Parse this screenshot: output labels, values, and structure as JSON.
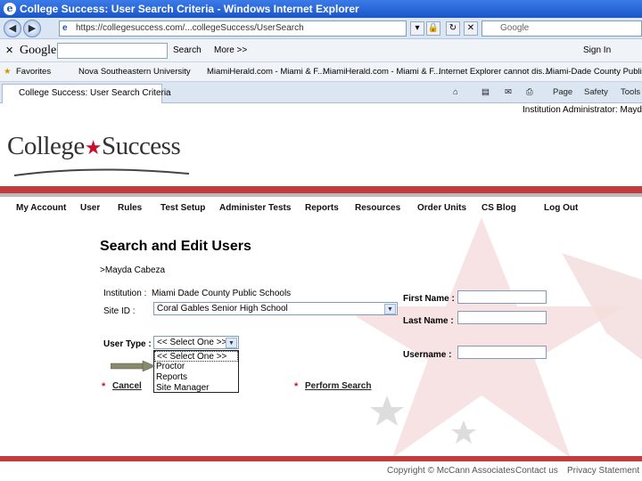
{
  "browser": {
    "title": "College Success: User Search Criteria - Windows Internet Explorer",
    "url": "https://collegesuccess.com/...collegeSuccess/UserSearch",
    "search_placeholder": "Google",
    "google_bar": {
      "logo": "Google",
      "search_label": "Search",
      "more_label": "More >>",
      "sign_in": "Sign In"
    },
    "favorites": {
      "label": "Favorites",
      "items": [
        "Nova Southeastern University",
        "MiamiHerald.com - Miami & F...",
        "MiamiHerald.com - Miami & F...",
        "Internet Explorer cannot dis...",
        "Miami-Dade County Public S"
      ]
    },
    "tab": "College Success: User Search Criteria",
    "tools": {
      "page": "Page",
      "safety": "Safety",
      "tools": "Tools"
    }
  },
  "page": {
    "institution_header": "Institution Administrator: Mayda C",
    "logo": {
      "left": "College",
      "right": "Success"
    },
    "nav": [
      "My Account",
      "User",
      "Rules",
      "Test Setup",
      "Administer Tests",
      "Reports",
      "Resources",
      "Order Units",
      "CS Blog",
      "Log Out"
    ],
    "title": "Search and Edit Users",
    "breadcrumb": ">Mayda Cabeza",
    "form": {
      "institution_label": "Institution :",
      "institution_value": "Miami Dade County Public Schools",
      "site_id_label": "Site ID :",
      "site_id_value": "Coral Gables Senior High School",
      "user_type_label": "User Type :",
      "user_type_value": "<< Select One >>",
      "user_type_options": [
        "<< Select One >>",
        "Proctor",
        "Reports",
        "Site Manager"
      ],
      "first_name_label": "First Name :",
      "last_name_label": "Last Name :",
      "username_label": "Username :",
      "cancel_label": "Cancel",
      "search_label": "Perform Search"
    },
    "footer": {
      "copyright": "Copyright © McCann Associates",
      "contact": "Contact us",
      "privacy": "Privacy Statement"
    }
  }
}
